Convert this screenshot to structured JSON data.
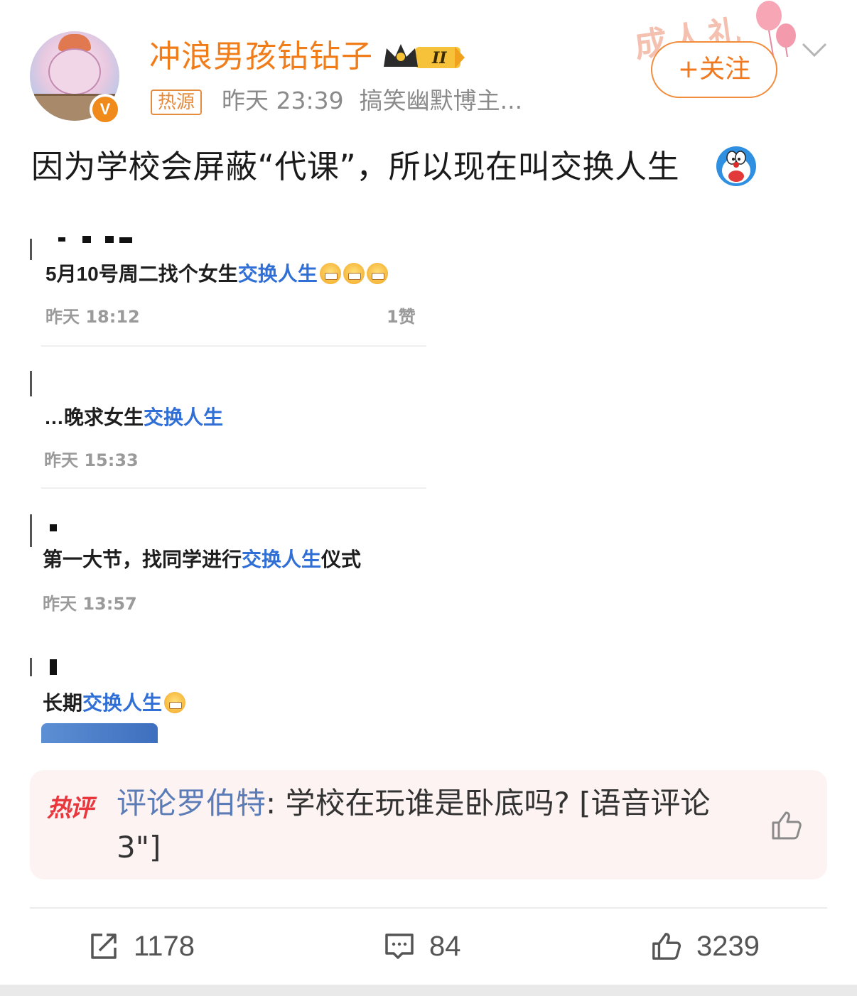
{
  "post": {
    "author": "冲浪男孩钻钻子",
    "verified_mark": "V",
    "tag": "热源",
    "time": "昨天 23:39",
    "author_desc": "搞笑幽默博主...",
    "follow_label": "+关注",
    "banner_text": "成人礼",
    "text": "因为学校会屏蔽“代课”，所以现在叫交换人生",
    "emoji_icon": "doraemon-emoji-icon"
  },
  "screenshot": {
    "items": [
      {
        "pre": "5月10号周二找个女生",
        "link": "交换人生",
        "time": "昨天 18:12",
        "likes": "1赞"
      },
      {
        "pre": "…晚求女生",
        "link": "交换人生",
        "time": "昨天 15:33"
      },
      {
        "pre": "第一大节，找同学进行",
        "link": "交换人生",
        "post": "仪式",
        "time": "昨天 13:57"
      },
      {
        "pre": "长期",
        "link": "交换人生"
      }
    ]
  },
  "hot_comment": {
    "label": "热评",
    "author": "评论罗伯特",
    "text": ": 学校在玩谁是卧底吗?  [语音评论 3\"]"
  },
  "actions": {
    "repost": "1178",
    "comment": "84",
    "like": "3239"
  },
  "colors": {
    "accent": "#f07c1a",
    "link_blue": "#2f6fd6",
    "hot_red": "#e8383d"
  }
}
